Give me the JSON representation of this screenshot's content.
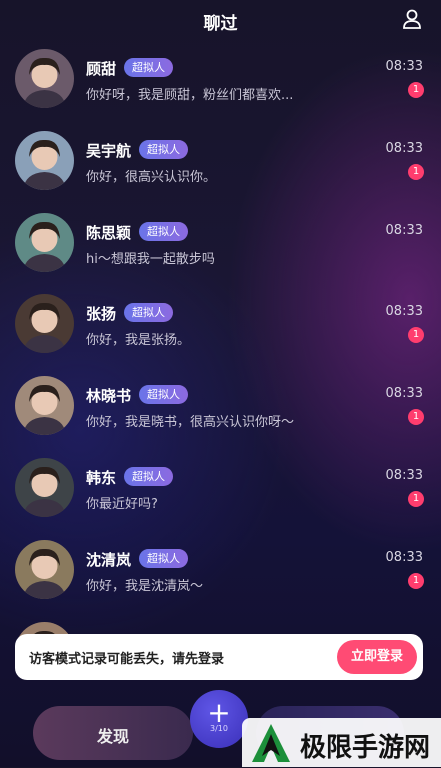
{
  "header": {
    "title": "聊过",
    "profile_icon": "user-icon"
  },
  "chats": [
    {
      "name": "顾甜",
      "badge": "超拟人",
      "message": "你好呀，我是顾甜，粉丝们都喜欢...",
      "time": "08:33",
      "unread": "1",
      "avatar_color": "#6b5a6a"
    },
    {
      "name": "吴宇航",
      "badge": "超拟人",
      "message": "你好，很高兴认识你。",
      "time": "08:33",
      "unread": "1",
      "avatar_color": "#8aa0b8"
    },
    {
      "name": "陈思颖",
      "badge": "超拟人",
      "message": "hi～想跟我一起散步吗",
      "time": "08:33",
      "unread": "",
      "avatar_color": "#5f8a86"
    },
    {
      "name": "张扬",
      "badge": "超拟人",
      "message": "你好，我是张扬。",
      "time": "08:33",
      "unread": "1",
      "avatar_color": "#4a3a34"
    },
    {
      "name": "林晓书",
      "badge": "超拟人",
      "message": "你好，我是晓书，很高兴认识你呀～",
      "time": "08:33",
      "unread": "1",
      "avatar_color": "#a08a7a"
    },
    {
      "name": "韩东",
      "badge": "",
      "message": "你最近好吗?",
      "time": "08:33",
      "unread": "1",
      "avatar_color": "#3e4448"
    },
    {
      "name": "沈清岚",
      "badge": "超拟人",
      "message": "你好，我是沈清岚～",
      "time": "08:33",
      "unread": "1",
      "avatar_color": "#8a7a5e"
    },
    {
      "name": "",
      "badge": "",
      "message": "",
      "time": "",
      "unread": "",
      "avatar_color": "#9a7e6a"
    }
  ],
  "chat_badges": {
    "韩东": "超拟人"
  },
  "toast": {
    "text": "访客模式记录可能丢失，请先登录",
    "button": "立即登录"
  },
  "tabbar": {
    "discover": "发现",
    "center_count": "3/10"
  },
  "watermark": {
    "text": "极限手游网"
  },
  "colors": {
    "accent": "#ff4b74",
    "badge": "#6a74e8",
    "unread_dot": "#ff3d6e"
  }
}
